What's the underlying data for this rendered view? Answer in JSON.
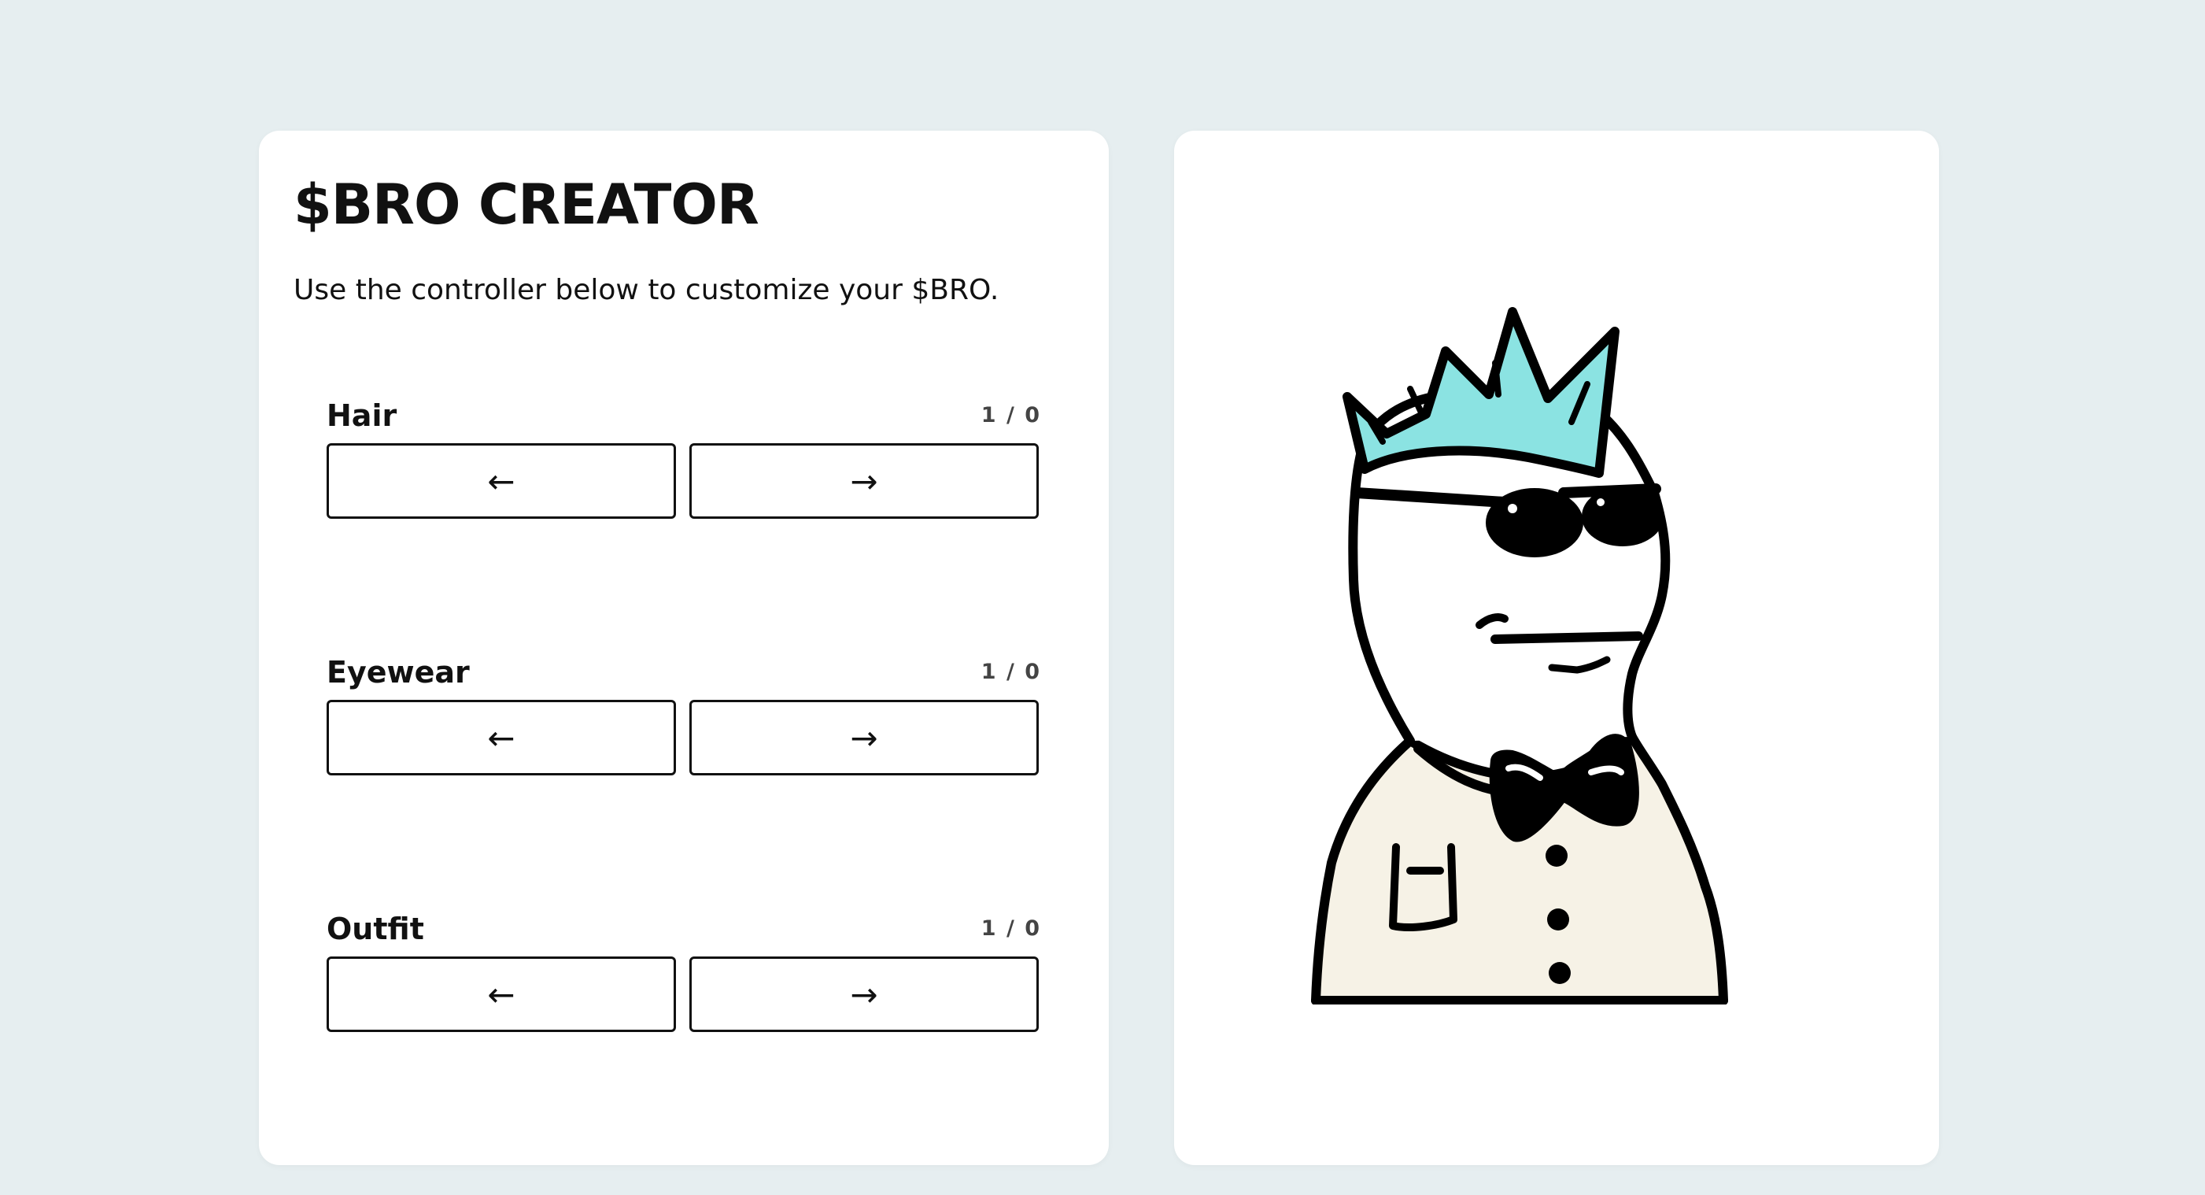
{
  "app": {
    "title": "$BRO CREATOR",
    "subtitle": "Use the controller below to customize your $BRO."
  },
  "controls": [
    {
      "label": "Hair",
      "count": "1 / 0",
      "prev_label": "←",
      "next_label": "→"
    },
    {
      "label": "Eyewear",
      "count": "1 / 0",
      "prev_label": "←",
      "next_label": "→"
    },
    {
      "label": "Outfit",
      "count": "1 / 0",
      "prev_label": "←",
      "next_label": "→"
    }
  ],
  "preview": {
    "hair_color": "#8be3e2",
    "outfit_color": "#f6f2e6",
    "line_color": "#000000"
  },
  "colors": {
    "background": "#e6eef0",
    "panel": "#ffffff"
  }
}
